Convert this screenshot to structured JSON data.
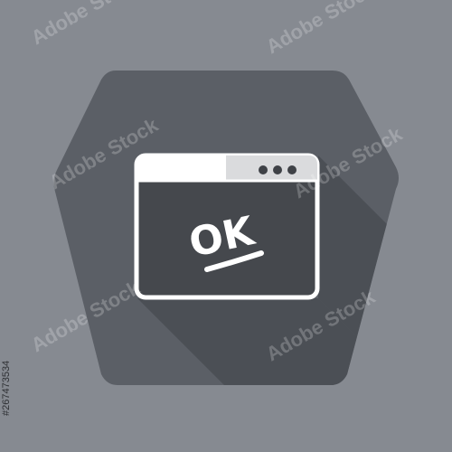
{
  "icon": {
    "name": "browser-window-ok-icon",
    "ok_text": "OK",
    "window_controls": [
      "dot",
      "dot",
      "dot"
    ]
  },
  "watermark": {
    "text": "Adobe Stock",
    "stock_id": "#267473534"
  },
  "colors": {
    "background": "#868a91",
    "hexagon": "#5b5f66",
    "long_shadow": "#4b4f55",
    "window_fill": "#45484d",
    "window_stroke": "#ffffff",
    "titlebar_light": "#ffffff",
    "titlebar_dim": "#dadbdd",
    "dots": "#3f4247"
  }
}
